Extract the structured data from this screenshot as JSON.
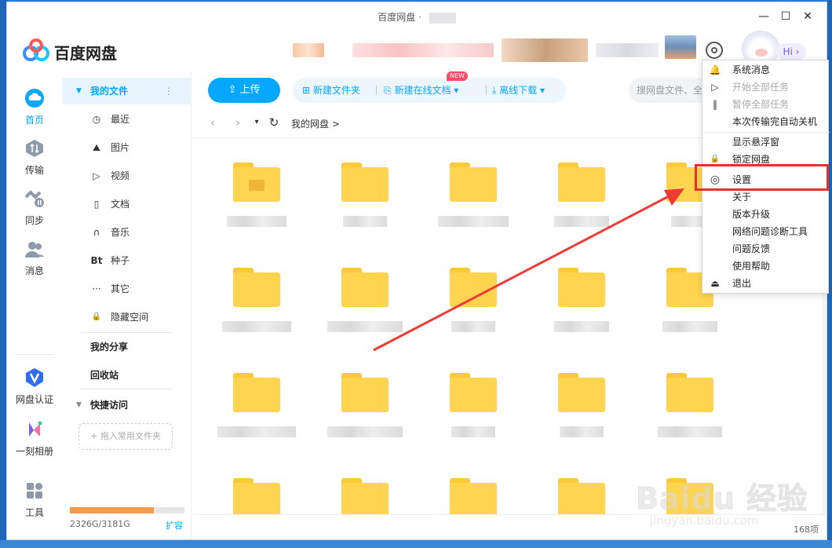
{
  "window": {
    "title": "百度网盘",
    "title_sep": "·",
    "minimize": "—",
    "maximize": "☐",
    "close": "✕"
  },
  "header": {
    "logo_text": "百度网盘",
    "hi": "Hi ›"
  },
  "leftbar": {
    "items": [
      {
        "label": "首页",
        "icon": "cloud-icon",
        "active": true
      },
      {
        "label": "传输",
        "icon": "transfer-icon"
      },
      {
        "label": "同步",
        "icon": "sync-icon"
      },
      {
        "label": "消息",
        "icon": "message-icon"
      },
      {
        "label": "网盘认证",
        "icon": "verify-icon"
      },
      {
        "label": "一刻相册",
        "icon": "album-icon"
      },
      {
        "label": "工具",
        "icon": "tools-icon"
      }
    ]
  },
  "sidebar": {
    "my_files": "我的文件",
    "more": "⋮",
    "items": [
      {
        "label": "最近",
        "glyph": "◷"
      },
      {
        "label": "图片",
        "glyph": "⛰"
      },
      {
        "label": "视频",
        "glyph": "▷"
      },
      {
        "label": "文档",
        "glyph": "▯"
      },
      {
        "label": "音乐",
        "glyph": "∩"
      },
      {
        "label": "种子",
        "glyph": "Bt"
      },
      {
        "label": "其它",
        "glyph": "···"
      },
      {
        "label": "隐藏空间",
        "glyph": "🔒"
      }
    ],
    "my_share": "我的分享",
    "recycle": "回收站",
    "quick_access": "快捷访问",
    "drag_hint": "+ 拖入常用文件夹",
    "storage_text": "2326G/3181G",
    "storage_fraction": 0.731,
    "expand": "扩容"
  },
  "toolbar": {
    "upload": "上传",
    "new_folder": "新建文件夹",
    "new_online_doc": "新建在线文档 ▾",
    "new_badge": "NEW",
    "offline_download": "离线下载 ▾",
    "search_placeholder": "搜网盘文件、全"
  },
  "nav": {
    "back": "‹",
    "forward": "›",
    "dropdown": "▾",
    "refresh": "↻",
    "breadcrumb": "我的网盘  >"
  },
  "status": {
    "count": "168项"
  },
  "menu": {
    "items": [
      {
        "label": "系统消息",
        "glyph": "🔔",
        "disabled": false
      },
      {
        "label": "开始全部任务",
        "glyph": "▷",
        "disabled": true
      },
      {
        "label": "暂停全部任务",
        "glyph": "‖",
        "disabled": true
      },
      {
        "label": "本次传输完自动关机",
        "glyph": "",
        "disabled": false
      },
      {
        "label": "显示悬浮窗",
        "glyph": "",
        "disabled": false
      },
      {
        "label": "锁定网盘",
        "glyph": "🔒",
        "disabled": false
      },
      {
        "label": "设置",
        "glyph": "◎",
        "disabled": false
      },
      {
        "label": "关于",
        "glyph": "",
        "disabled": false
      },
      {
        "label": "版本升级",
        "glyph": "",
        "disabled": false
      },
      {
        "label": "网络问题诊断工具",
        "glyph": "",
        "disabled": false
      },
      {
        "label": "问题反馈",
        "glyph": "",
        "disabled": false
      },
      {
        "label": "使用帮助",
        "glyph": "",
        "disabled": false
      },
      {
        "label": "退出",
        "glyph": "⏏",
        "disabled": false
      }
    ]
  },
  "watermark": {
    "big": "Baidu 经验",
    "small": "jingyan.baidu.com"
  },
  "colors": {
    "accent": "#06a7ff",
    "folder": "#ffd54f",
    "highlight": "#e8312f"
  }
}
